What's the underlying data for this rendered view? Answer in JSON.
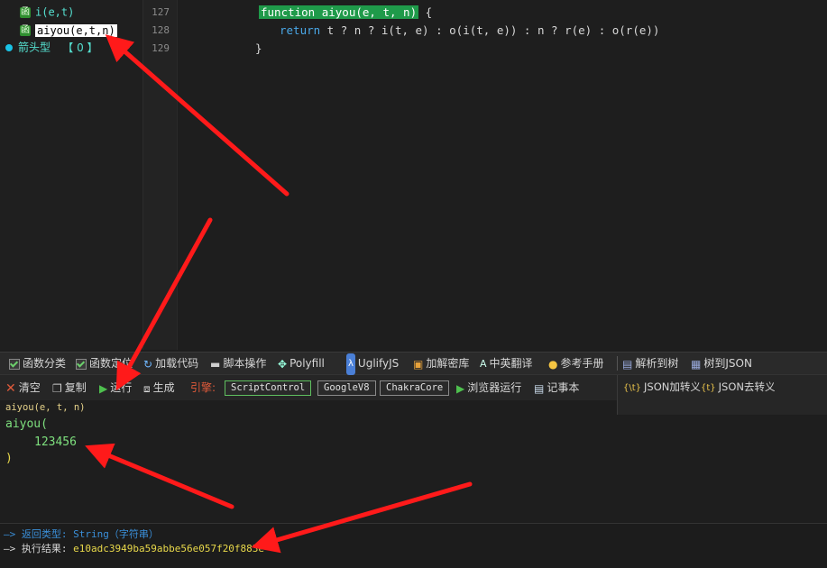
{
  "tree": {
    "items": [
      {
        "icon": "函",
        "label": "i(e,t)"
      },
      {
        "icon": "函",
        "label": "aiyou(e,t,n)"
      }
    ],
    "arrow_type": {
      "label": "箭头型",
      "count": "【 0 】"
    }
  },
  "editor": {
    "lines": [
      {
        "num": "127",
        "pre": "function aiyou(e, t, n)",
        "post": " {"
      },
      {
        "num": "128",
        "keyword": "return",
        "rest": " t ? n ? i(t, e) : o(i(t, e)) : n ? r(e) : o(r(e))"
      },
      {
        "num": "129",
        "text": "}"
      }
    ]
  },
  "toolbar1": {
    "func_category": "函数分类",
    "func_locate": "函数定位",
    "load_code": "加载代码",
    "script_ops": "脚本操作",
    "polyfill": "Polyfill",
    "uglifyjs": "UglifyJS",
    "decrypt_lib": "加解密库",
    "translate": "中英翻译",
    "manual": "参考手册",
    "parse_tree": "解析到树",
    "tree_json": "树到JSON"
  },
  "toolbar2": {
    "clear": "清空",
    "copy": "复制",
    "run": "运行",
    "generate": "生成",
    "engine_label": "引擎:",
    "engines": [
      "ScriptControl",
      "GoogleV8",
      "ChakraCore"
    ],
    "browser_run": "浏览器运行",
    "notepad": "记事本",
    "json_escape": "JSON加转义",
    "json_unescape": "JSON去转义",
    "json_escape_icon": "{\\t}",
    "json_unescape_icon": "{t}"
  },
  "output": {
    "signature": "aiyou(e, t, n)",
    "line1": "aiyou(",
    "arg": "123456",
    "line3": ")"
  },
  "status": {
    "return_type": "—> 返回类型: String（字符串）",
    "result_label": "—> 执行结果:",
    "result_value": "e10adc3949ba59abbe56e057f20f883e"
  },
  "colors": {
    "accent_green": "#1f9a4a",
    "arrow_red": "#ff1a1a",
    "return_type_blue": "#3a8fd9"
  }
}
